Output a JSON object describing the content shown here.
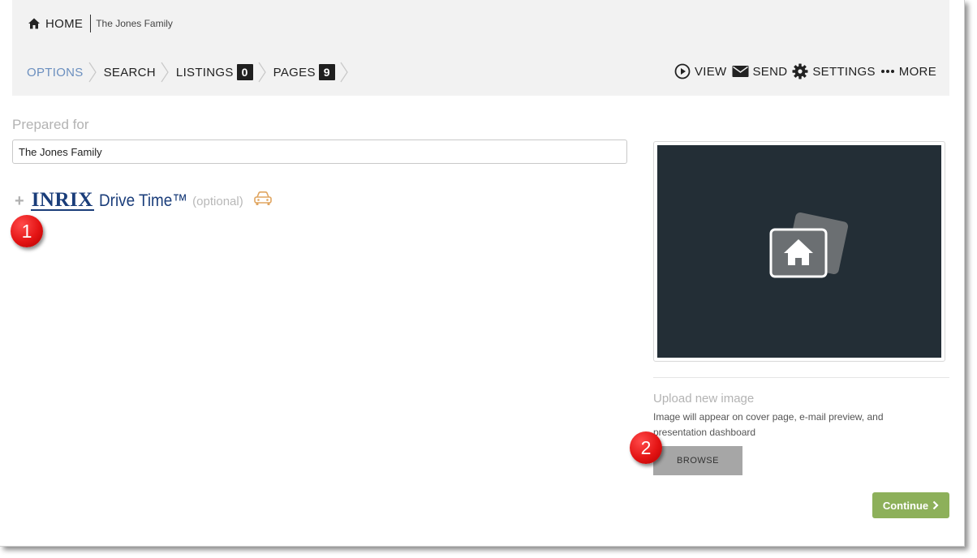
{
  "header": {
    "home_label": "HOME",
    "family_name": "The Jones Family",
    "steps": [
      {
        "label": "OPTIONS"
      },
      {
        "label": "SEARCH"
      },
      {
        "label": "LISTINGS",
        "count": "0"
      },
      {
        "label": "PAGES",
        "count": "9"
      }
    ],
    "actions": {
      "view": "VIEW",
      "send": "SEND",
      "settings": "SETTINGS",
      "more": "MORE"
    }
  },
  "form": {
    "prepared_label": "Prepared for",
    "prepared_value": "The Jones Family"
  },
  "drive_time": {
    "logo": "INRIX",
    "title": "Drive Time™",
    "optional": "(optional)"
  },
  "image_panel": {
    "upload_title": "Upload new image",
    "upload_desc": "Image will appear on cover page, e-mail preview, and presentation dashboard",
    "browse_label": "BROWSE"
  },
  "footer": {
    "continue_label": "Continue"
  },
  "callouts": [
    "1",
    "2"
  ],
  "colors": {
    "active_step": "#6b8fbf",
    "header_bg": "#f2f2f2",
    "continue_bg": "#8db05a",
    "browse_bg": "#a6a6a6",
    "image_bg": "#232e36",
    "callout_red": "#e41414",
    "inrix_blue": "#1a3d7a"
  }
}
